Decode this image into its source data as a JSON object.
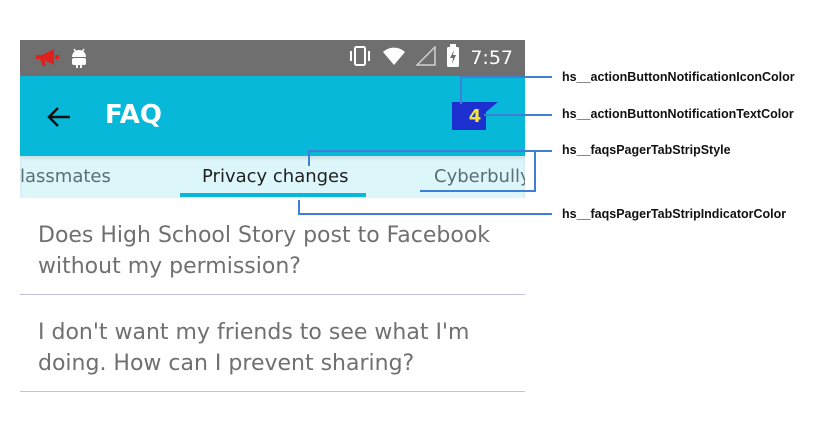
{
  "status_bar": {
    "time": "7:57",
    "icons_left": [
      "megaphone-icon",
      "android-icon"
    ],
    "icons_right": [
      "vibrate-icon",
      "wifi-icon",
      "signal-icon",
      "battery-charging-icon"
    ]
  },
  "app_bar": {
    "title": "FAQ",
    "notification_count": "4",
    "background_color": "#08b8d8"
  },
  "tabs": [
    {
      "label": "lassmates",
      "active": false
    },
    {
      "label": "Privacy changes",
      "active": true
    },
    {
      "label": "Cyberbully",
      "active": false
    }
  ],
  "faq_items": [
    {
      "line1": "Does High School Story post to Facebook",
      "line2": "without my permission?"
    },
    {
      "line1": "I don't want my friends to see what I'm",
      "line2": "doing. How can I prevent sharing?"
    }
  ],
  "annotations": [
    {
      "label": "hs__actionButtonNotificationIconColor"
    },
    {
      "label": "hs__actionButtonNotificationTextColor"
    },
    {
      "label": "hs__faqsPagerTabStripStyle"
    },
    {
      "label": "hs__faqsPagerTabStripIndicatorColor"
    }
  ],
  "colors": {
    "status_bar": "#6f6f6f",
    "tab_strip": "#dcf6f9",
    "indicator": "#08b8d8",
    "badge": "#1e2fd0",
    "badge_text": "#f4e43a",
    "annotation_line": "#3f7fd6"
  }
}
